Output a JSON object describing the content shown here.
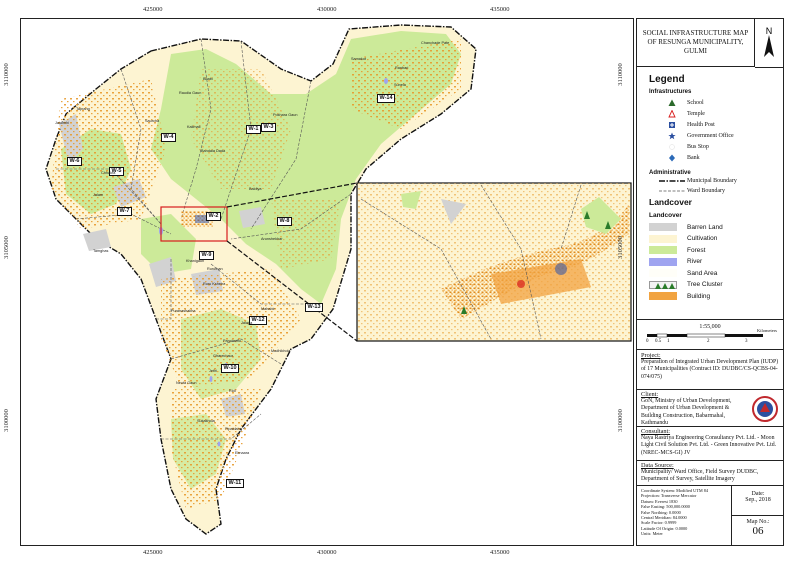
{
  "map": {
    "x_ticks": [
      "425000",
      "430000",
      "435000"
    ],
    "y_ticks": [
      "3110000",
      "3105000",
      "3100000"
    ],
    "ward_labels": [
      "W-1",
      "W-2",
      "W-3",
      "W-4",
      "W-5",
      "W-6",
      "W-7",
      "W-8",
      "W-9",
      "W-10",
      "W-11",
      "W-12",
      "W-13",
      "W-14"
    ],
    "place_labels": [
      "Chanchade Pate",
      "Samakot",
      "Ranbari",
      "Sunela",
      "Bhabi",
      "Raudia Gaun",
      "Saurcha",
      "Kalimati",
      "Pokhara Gaun",
      "Bandala Dada",
      "Taprang",
      "Jaidimhi",
      "Chhakra",
      "Jalam",
      "Baldiya",
      "Arunshekhar",
      "Tamghas",
      "Khanigaun",
      "Ruruthan",
      "Ruru Kshetra",
      "Mahabir",
      "Puranashakha",
      "Jalapa",
      "Panchamu",
      "Gharechaur",
      "Jethi",
      "Ridi",
      "Neuta Gaun",
      "Madhikhola",
      "Sukakhola",
      "Pipaldaha",
      "Eknaara"
    ],
    "colors": {
      "forest": "#ccea99",
      "cultivation": "#fdf4d2",
      "barren": "#d2d2d2",
      "building": "#f1a340",
      "river": "#9fa4f0",
      "boundary": "#111111"
    }
  },
  "panel": {
    "title": "SOCIAL INFRASTRUCTURE MAP OF RESUNGA MUNICIPALITY, GULMI",
    "north": "N",
    "legend_title": "Legend",
    "infra_heading": "Infrastructures",
    "infra": [
      {
        "label": "School",
        "icon": "school-icon"
      },
      {
        "label": "Temple",
        "icon": "temple-icon"
      },
      {
        "label": "Health Post",
        "icon": "health-post-icon"
      },
      {
        "label": "Government Office",
        "icon": "government-office-icon"
      },
      {
        "label": "Bus Stop",
        "icon": "bus-stop-icon"
      },
      {
        "label": "Bank",
        "icon": "bank-icon"
      }
    ],
    "admin_heading": "Administrative",
    "admin": [
      {
        "label": "Municipal Boundary"
      },
      {
        "label": "Ward Boundary"
      }
    ],
    "landcover_title": "Landcover",
    "landcover_sub": "Landcover",
    "landcover": [
      {
        "label": "Barren Land",
        "color": "#d2d2d2"
      },
      {
        "label": "Cultivation",
        "color": "#fdf4d2"
      },
      {
        "label": "Forest",
        "color": "#ccea99"
      },
      {
        "label": "River",
        "color": "#9fa4f0"
      },
      {
        "label": "Sand Area",
        "color": "#fffef8"
      },
      {
        "label": "Tree Cluster",
        "color": "#f3f3f3"
      },
      {
        "label": "Building",
        "color": "#f1a340"
      }
    ],
    "scale_text": "1:55,000",
    "scale_ticks": [
      "0",
      "0.5",
      "1",
      "2",
      "3"
    ],
    "scale_unit": "Kilometers",
    "project_hd": "Project:",
    "project": "Preparation of Integrated Urban Development Plan (IUDP) of 17 Municipalities (Contract ID: DUDBC/CS-QCBS-04-074/075)",
    "client_hd": "Client:",
    "client": "GoN, Ministry of Urban Development, Department of Urban Development & Building Construction, Babarmahal, Kathmandu",
    "consultant_hd": "Consultant:",
    "consultant": "Naya Rastriya Engineering Consultancy Pvt. Ltd. - Moon Light Civil Solution Pvt. Ltd. - Green Innovative Pvt. Ltd. (NREC-MCS-GI) JV",
    "source_hd": "Data Source:",
    "source": "Municipality/ Ward Office, Field Survey DUDBC, Department of Survey, Satellite Imagery",
    "coord_system": [
      "Coordinate System: Modified UTM 84",
      "Projection: Transverse Mercator",
      "Datum: Everest 1830",
      "False Easting: 500,000.0000",
      "False Northing: 0.0000",
      "Central Meridian: 84.0000",
      "Scale Factor: 0.9999",
      "Latitude Of Origin: 0.0000",
      "Units: Meter"
    ],
    "date_label": "Date:",
    "date": "Sep., 2018",
    "mapno_label": "Map No.:",
    "mapno": "06"
  }
}
